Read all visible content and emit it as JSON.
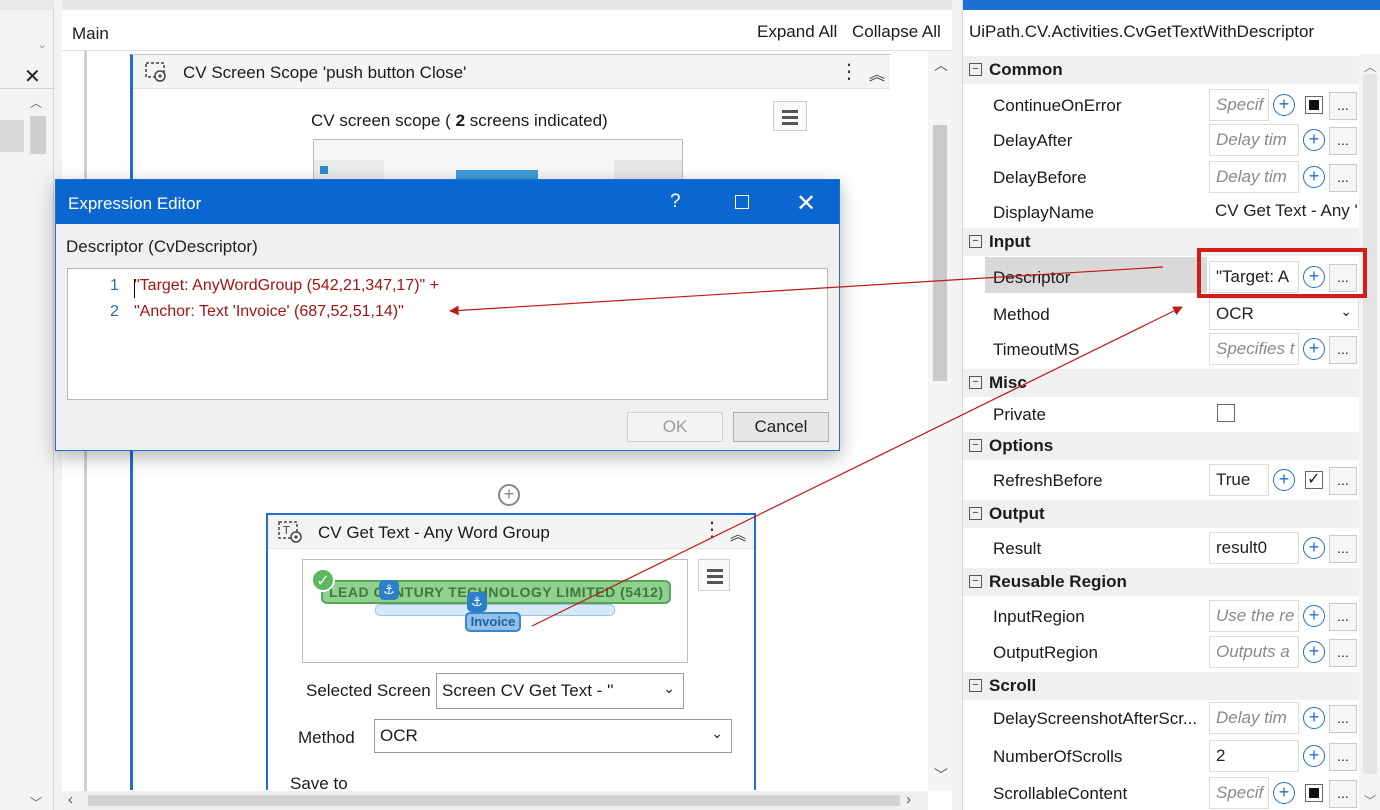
{
  "designer": {
    "breadcrumb": "Main",
    "expand_all": "Expand All",
    "collapse_all": "Collapse All"
  },
  "scope": {
    "title": "CV Screen Scope 'push button  Close'",
    "summary_prefix": "CV screen scope ( ",
    "summary_count": "2",
    "summary_suffix": " screens indicated)"
  },
  "gettext": {
    "title": "CV Get Text - Any Word Group",
    "thumb_text": "LEAD CENTURY TECHNOLOGY LIMITED (5412)",
    "thumb_invoice": "Invoice",
    "selected_screen_label": "Selected Screen",
    "selected_screen_value": "Screen CV Get Text - ''",
    "method_label": "Method",
    "method_value": "OCR",
    "save_to_label": "Save to"
  },
  "expression_editor": {
    "title": "Expression Editor",
    "help": "?",
    "descriptor_label": "Descriptor (CvDescriptor)",
    "lines": [
      {
        "num": "1",
        "code": "\"Target: AnyWordGroup (542,21,347,17)\" +"
      },
      {
        "num": "2",
        "code": "\"Anchor: Text 'Invoice' (687,52,51,14)\""
      }
    ],
    "ok_label": "OK",
    "cancel_label": "Cancel"
  },
  "properties": {
    "class_name": "UiPath.CV.Activities.CvGetTextWithDescriptor",
    "categories": [
      {
        "label": "Common",
        "rows": [
          {
            "name": "ContinueOnError",
            "value": "Specif",
            "placeholder": true
          },
          {
            "name": "DelayAfter",
            "value": "Delay tim",
            "placeholder": true
          },
          {
            "name": "DelayBefore",
            "value": "Delay tim",
            "placeholder": true
          },
          {
            "name": "DisplayName",
            "value": "CV Get Text - Any '"
          }
        ]
      },
      {
        "label": "Input",
        "rows": [
          {
            "name": "Descriptor",
            "value": "\"Target: A"
          },
          {
            "name": "Method",
            "value": "OCR"
          },
          {
            "name": "TimeoutMS",
            "value": "Specifies t",
            "placeholder": true
          }
        ]
      },
      {
        "label": "Misc",
        "rows": [
          {
            "name": "Private",
            "value": ""
          }
        ]
      },
      {
        "label": "Options",
        "rows": [
          {
            "name": "RefreshBefore",
            "value": "True"
          }
        ]
      },
      {
        "label": "Output",
        "rows": [
          {
            "name": "Result",
            "value": "result0"
          }
        ]
      },
      {
        "label": "Reusable Region",
        "rows": [
          {
            "name": "InputRegion",
            "value": "Use the re",
            "placeholder": true
          },
          {
            "name": "OutputRegion",
            "value": "Outputs a",
            "placeholder": true
          }
        ]
      },
      {
        "label": "Scroll",
        "rows": [
          {
            "name": "DelayScreenshotAfterScr...",
            "value": "Delay tim",
            "placeholder": true
          },
          {
            "name": "NumberOfScrolls",
            "value": "2"
          },
          {
            "name": "ScrollableContent",
            "value": "Specif",
            "placeholder": true
          }
        ]
      }
    ]
  },
  "colors": {
    "accent": "#1f6fcf",
    "titlebar": "#0b66d0",
    "highlight": "#d41c1c",
    "code_string": "#a31515"
  }
}
